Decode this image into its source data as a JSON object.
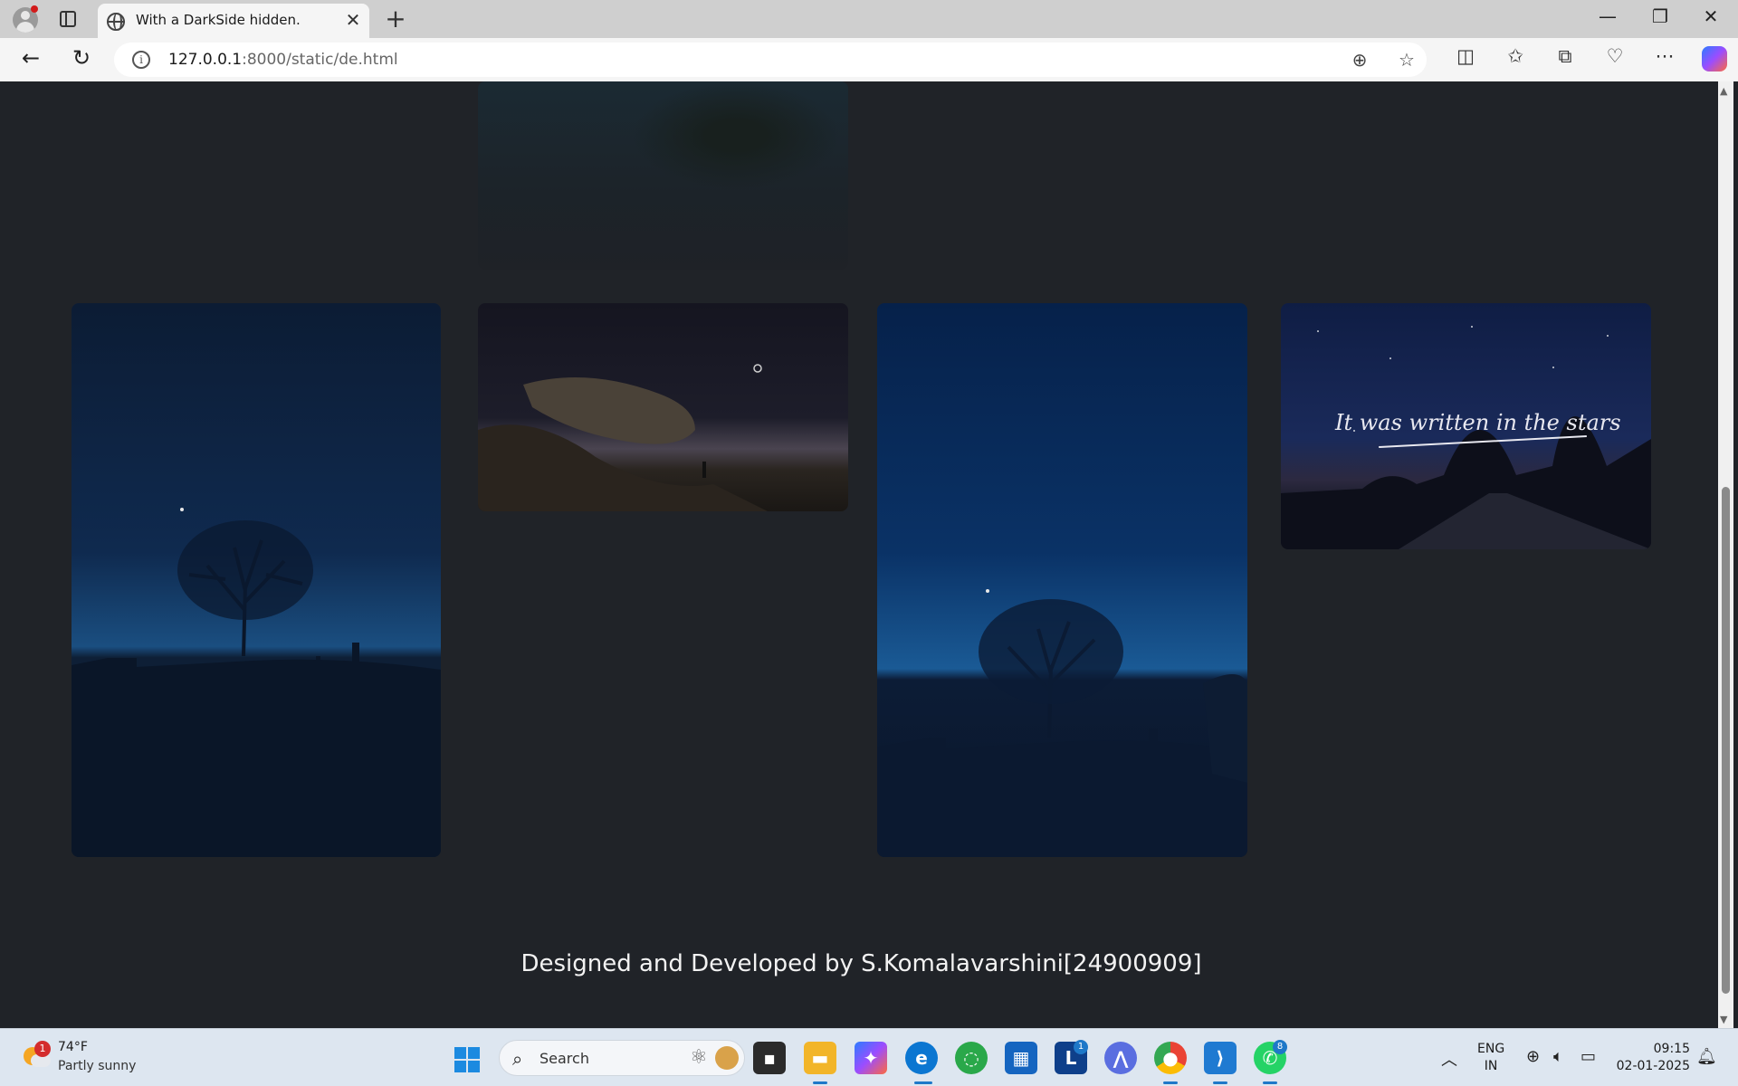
{
  "browser": {
    "tab_title": "With a DarkSide hidden.",
    "url_host": "127.0.0.1",
    "url_rest": ":8000/static/de.html",
    "new_tab_symbol": "+",
    "close_tab_symbol": "✕"
  },
  "page": {
    "gallery": [
      {
        "name": "misty-forest-photo"
      },
      {
        "name": "tree-under-moon-photo"
      },
      {
        "name": "rock-ledge-night-photo"
      },
      {
        "name": "tree-fence-blue-hour-photo"
      },
      {
        "name": "stars-road-trees-photo",
        "overlay_text": "It was written in the stars"
      }
    ],
    "footer": "Designed and Developed by S.Komalavarshini[24900909]"
  },
  "taskbar": {
    "weather": {
      "badge": "1",
      "temp": "74°F",
      "desc": "Partly sunny"
    },
    "search_placeholder": "Search",
    "apps": [
      {
        "name": "file-explorer-app",
        "badge": ""
      },
      {
        "name": "edge-app",
        "badge": ""
      },
      {
        "name": "linkedin-app",
        "badge": "1"
      },
      {
        "name": "whatsapp-app",
        "badge": "8"
      }
    ],
    "language": {
      "line1": "ENG",
      "line2": "IN"
    },
    "time": "09:15",
    "date": "02-01-2025"
  },
  "colors": {
    "page_bg": "#202328",
    "accent": "#1e78c8"
  }
}
